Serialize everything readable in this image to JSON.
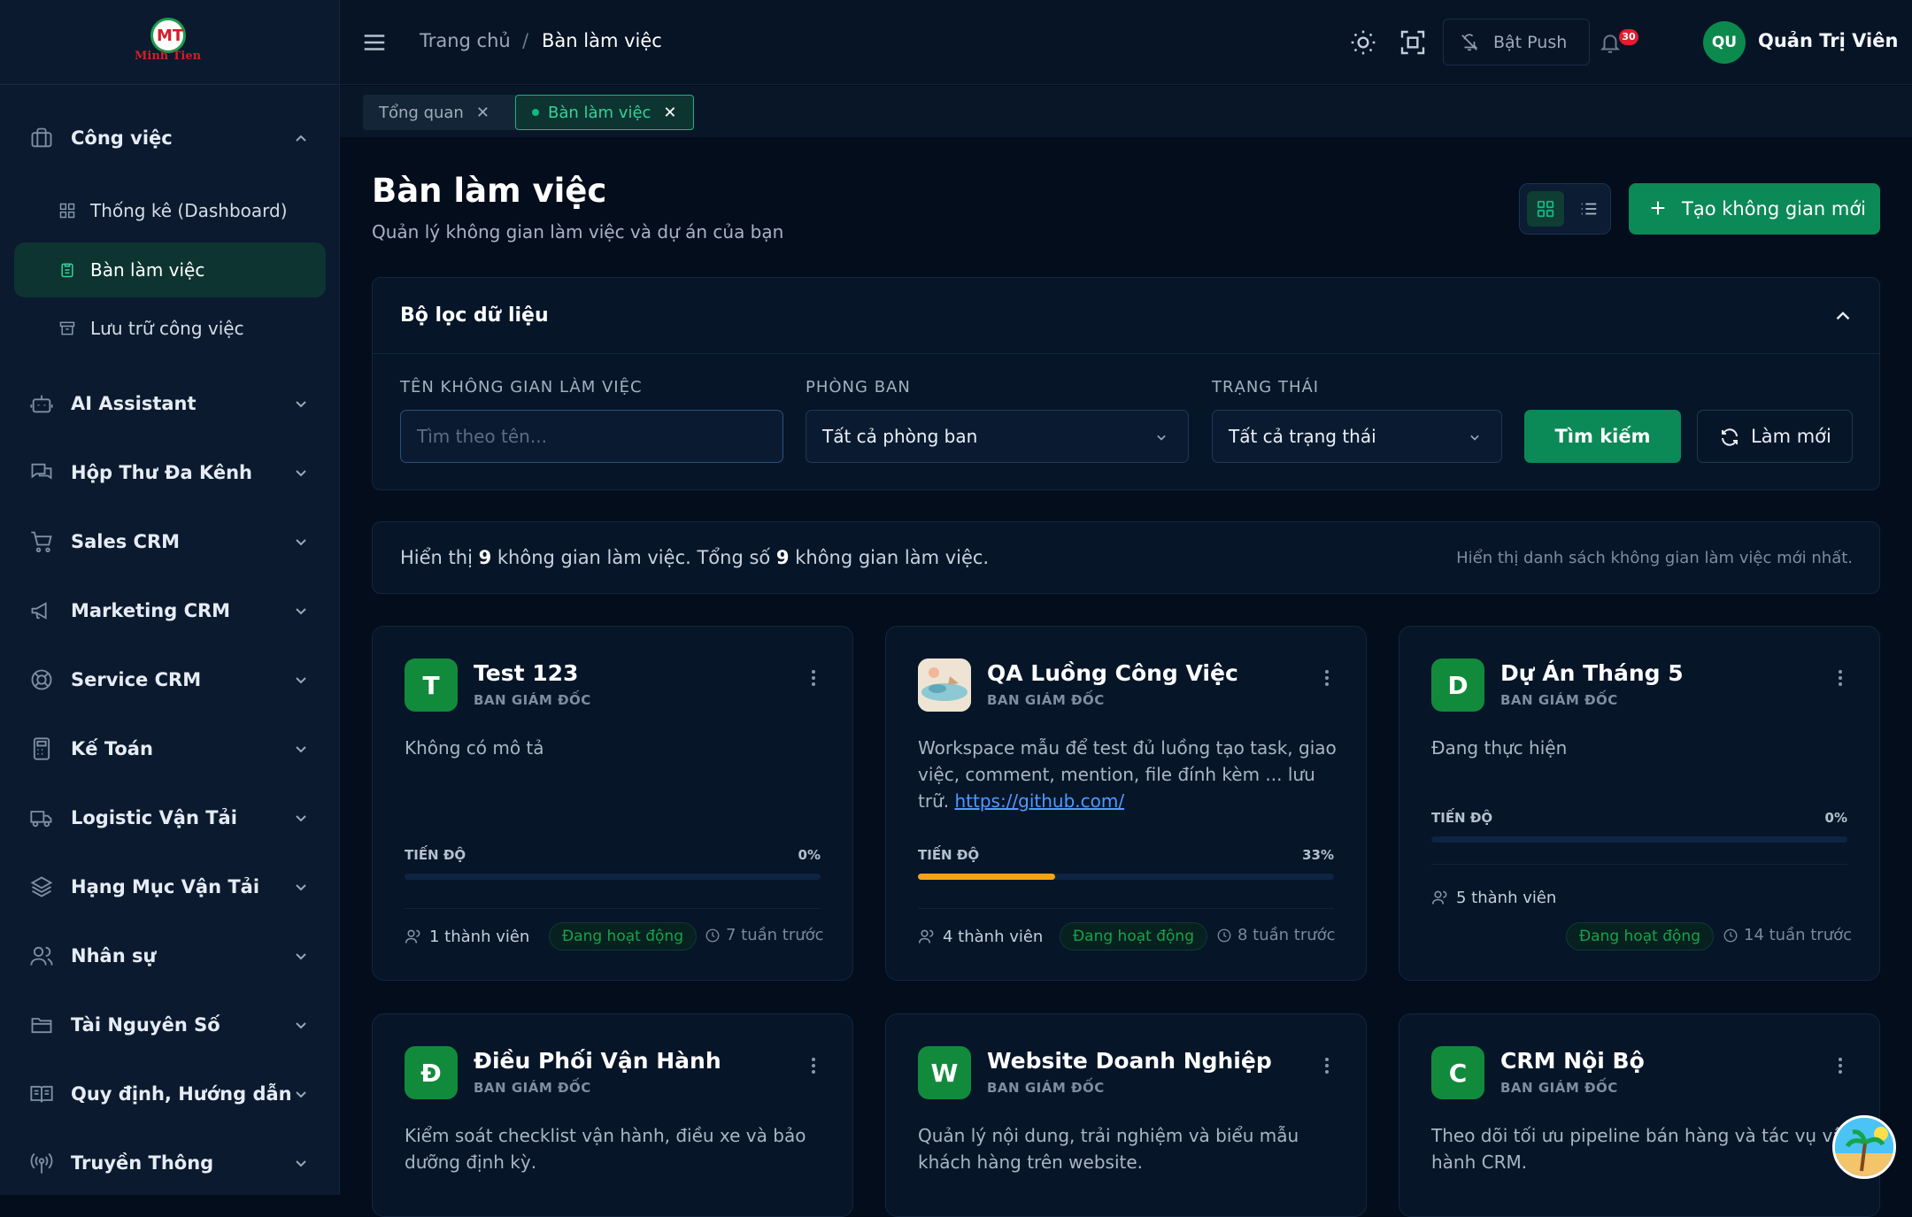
{
  "brand": {
    "logo_mark": "MT",
    "logo_text": "Minh Tien"
  },
  "sidebar": {
    "groups": [
      {
        "label": "Công việc",
        "icon": "briefcase-icon",
        "expanded": true,
        "items": [
          {
            "label": "Thống kê (Dashboard)",
            "icon": "dashboard-icon"
          },
          {
            "label": "Bàn làm việc",
            "icon": "clipboard-icon",
            "active": true
          },
          {
            "label": "Lưu trữ công việc",
            "icon": "archive-icon"
          }
        ]
      },
      {
        "label": "AI Assistant",
        "icon": "robot-icon"
      },
      {
        "label": "Hộp Thư Đa Kênh",
        "icon": "chat-icon"
      },
      {
        "label": "Sales CRM",
        "icon": "cart-icon"
      },
      {
        "label": "Marketing CRM",
        "icon": "megaphone-icon"
      },
      {
        "label": "Service CRM",
        "icon": "lifebuoy-icon"
      },
      {
        "label": "Kế Toán",
        "icon": "calculator-icon"
      },
      {
        "label": "Logistic Vận Tải",
        "icon": "truck-icon"
      },
      {
        "label": "Hạng Mục Vận Tải",
        "icon": "layers-icon"
      },
      {
        "label": "Nhân sự",
        "icon": "users-icon"
      },
      {
        "label": "Tài Nguyên Số",
        "icon": "folder-icon"
      },
      {
        "label": "Quy định, Hướng dẫn",
        "icon": "book-icon"
      },
      {
        "label": "Truyền Thông",
        "icon": "broadcast-icon"
      }
    ]
  },
  "topbar": {
    "breadcrumb": [
      "Trang chủ",
      "Bàn làm việc"
    ],
    "separator": "/",
    "push_label": "Bật Push",
    "notification_count": "30",
    "user_initials": "QU",
    "user_name": "Quản Trị Viên"
  },
  "tabs": [
    {
      "label": "Tổng quan",
      "active": false
    },
    {
      "label": "Bàn làm việc",
      "active": true
    }
  ],
  "page": {
    "title": "Bàn làm việc",
    "subtitle": "Quản lý không gian làm việc và dự án của bạn",
    "create_label": "Tạo không gian mới"
  },
  "filter": {
    "title": "Bộ lọc dữ liệu",
    "name_label": "TÊN KHÔNG GIAN LÀM VIỆC",
    "name_placeholder": "Tìm theo tên...",
    "dept_label": "PHÒNG BAN",
    "dept_value": "Tất cả phòng ban",
    "status_label": "TRẠNG THÁI",
    "status_value": "Tất cả trạng thái",
    "search_label": "Tìm kiếm",
    "reset_label": "Làm mới"
  },
  "info": {
    "prefix": "Hiển thị ",
    "shown": "9",
    "middle": " không gian làm việc. Tổng số ",
    "total": "9",
    "suffix": " không gian làm việc.",
    "right": "Hiển thị danh sách không gian làm việc mới nhất."
  },
  "progress_label": "TIẾN ĐỘ",
  "cards": [
    {
      "initial": "T",
      "title": "Test 123",
      "dept": "BAN GIÁM ĐỐC",
      "desc": "Không có mô tả",
      "progress": 0,
      "progress_text": "0%",
      "members": "1 thành viên",
      "status": "Đang hoạt động",
      "time": "7 tuần trước"
    },
    {
      "initial": "",
      "title": "QA Luồng Công Việc",
      "dept": "BAN GIÁM ĐỐC",
      "desc": "Workspace mẫu để test đủ luồng tạo task, giao việc, comment, mention, file đính kèm ... lưu trữ. ",
      "link": "https://github.com/",
      "progress": 33,
      "progress_text": "33%",
      "members": "4 thành viên",
      "status": "Đang hoạt động",
      "time": "8 tuần trước"
    },
    {
      "initial": "D",
      "title": "Dự Án Tháng 5",
      "dept": "BAN GIÁM ĐỐC",
      "desc": "Đang thực hiện",
      "progress": 0,
      "progress_text": "0%",
      "members": "5 thành viên",
      "status": "Đang hoạt động",
      "time": "14 tuần trước"
    },
    {
      "initial": "Đ",
      "title": "Điều Phối Vận Hành",
      "dept": "BAN GIÁM ĐỐC",
      "desc": "Kiểm soát checklist vận hành, điều xe và bảo dưỡng định kỳ."
    },
    {
      "initial": "W",
      "title": "Website Doanh Nghiệp",
      "dept": "BAN GIÁM ĐỐC",
      "desc": "Quản lý nội dung, trải nghiệm và biểu mẫu khách hàng trên website."
    },
    {
      "initial": "C",
      "title": "CRM Nội Bộ",
      "dept": "BAN GIÁM ĐỐC",
      "desc": "Theo dõi tối ưu pipeline bán hàng và tác vụ vận hành CRM."
    }
  ],
  "colors": {
    "accent": "#0b8a57",
    "progress_fill": "#f5a21b",
    "background": "#040d1c"
  }
}
